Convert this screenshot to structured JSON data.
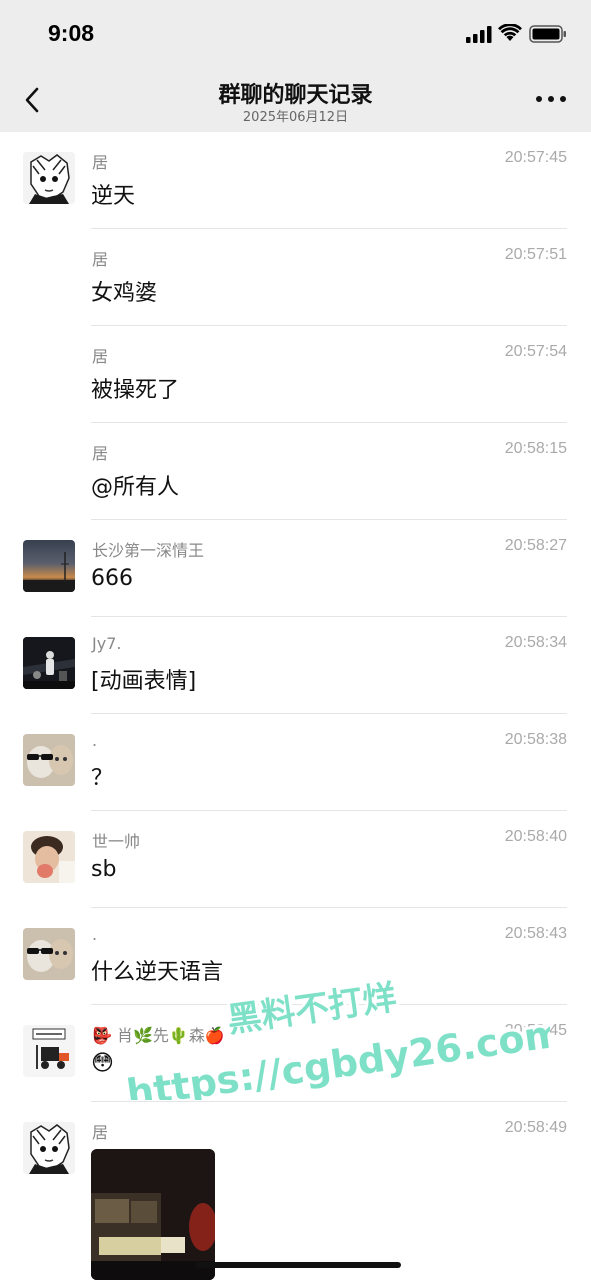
{
  "status": {
    "time": "9:08"
  },
  "nav": {
    "title": "群聊的聊天记录",
    "subtitle": "2025年06月12日"
  },
  "messages": [
    {
      "sender": "居",
      "time": "20:57:45",
      "text": "逆天"
    },
    {
      "sender": "居",
      "time": "20:57:51",
      "text": "女鸡婆"
    },
    {
      "sender": "居",
      "time": "20:57:54",
      "text": "被操死了"
    },
    {
      "sender": "居",
      "time": "20:58:15",
      "text": "@所有人"
    },
    {
      "sender": "长沙第一深情王",
      "time": "20:58:27",
      "text": "666"
    },
    {
      "sender": "Jy7.",
      "time": "20:58:34",
      "text": "[动画表情]"
    },
    {
      "sender": ".",
      "time": "20:58:38",
      "text": "？"
    },
    {
      "sender": "世一帅",
      "time": "20:58:40",
      "text": "sb"
    },
    {
      "sender": ".",
      "time": "20:58:43",
      "text": "什么逆天语言"
    },
    {
      "sender": "👺 肖🌿先🌵森🍎",
      "time": "20:58:45",
      "text": "😳"
    },
    {
      "sender": "居",
      "time": "20:58:49",
      "text": ""
    }
  ],
  "watermark": {
    "line1": "黑料不打烊",
    "line2": "https://cgbdy26.com"
  },
  "colors": {
    "bar_bg": "#ededed",
    "watermark_fill": "#7fe0c8"
  }
}
